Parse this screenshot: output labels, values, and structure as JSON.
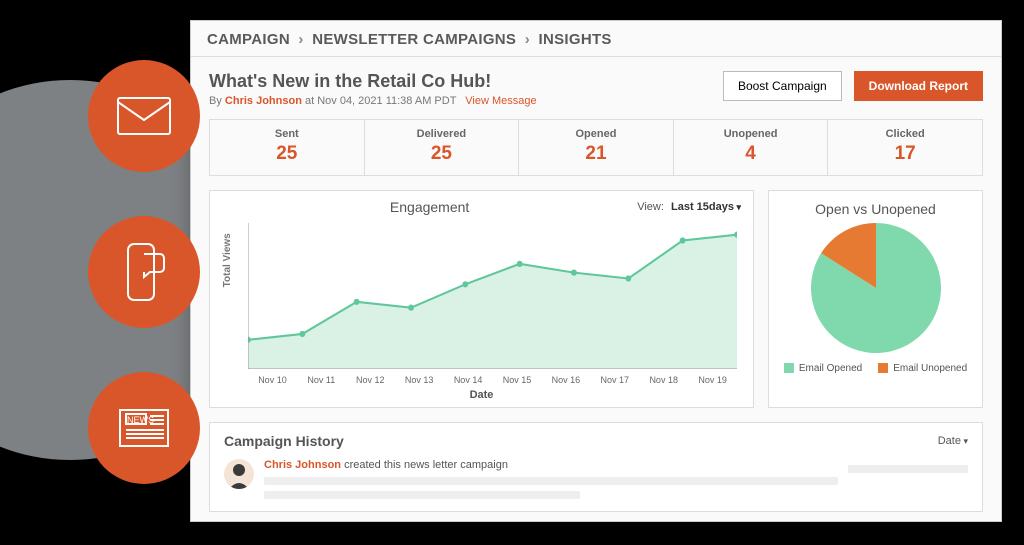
{
  "breadcrumb": {
    "a": "CAMPAIGN",
    "b": "NEWSLETTER CAMPAIGNS",
    "c": "INSIGHTS"
  },
  "header": {
    "title": "What's New in the Retail Co Hub!",
    "by_prefix": "By ",
    "author": "Chris Johnson",
    "at": " at Nov 04, 2021 11:38 AM PDT",
    "view_message": "View Message",
    "boost": "Boost Campaign",
    "download": "Download Report"
  },
  "stats": [
    {
      "label": "Sent",
      "value": "25"
    },
    {
      "label": "Delivered",
      "value": "25"
    },
    {
      "label": "Opened",
      "value": "21"
    },
    {
      "label": "Unopened",
      "value": "4"
    },
    {
      "label": "Clicked",
      "value": "17"
    }
  ],
  "chart_data": {
    "line": {
      "type": "area",
      "title": "Engagement",
      "view_label": "View:",
      "view_selected": "Last 15days",
      "xlabel": "Date",
      "ylabel": "Total Views",
      "ylim": [
        0,
        100
      ],
      "categories": [
        "Nov 10",
        "Nov 11",
        "Nov 12",
        "Nov 13",
        "Nov 14",
        "Nov 15",
        "Nov 16",
        "Nov 17",
        "Nov 18",
        "Nov 19"
      ],
      "values": [
        20,
        24,
        46,
        42,
        58,
        72,
        66,
        62,
        88,
        92
      ]
    },
    "pie": {
      "type": "pie",
      "title": "Open vs Unopened",
      "series": [
        {
          "name": "Email Opened",
          "value": 21,
          "color": "#7fd9ac"
        },
        {
          "name": "Email Unopened",
          "value": 4,
          "color": "#e67a33"
        }
      ]
    }
  },
  "history": {
    "title": "Campaign History",
    "sort_label": "Date",
    "row": {
      "author": "Chris Johnson",
      "text": " created this news letter campaign"
    }
  }
}
